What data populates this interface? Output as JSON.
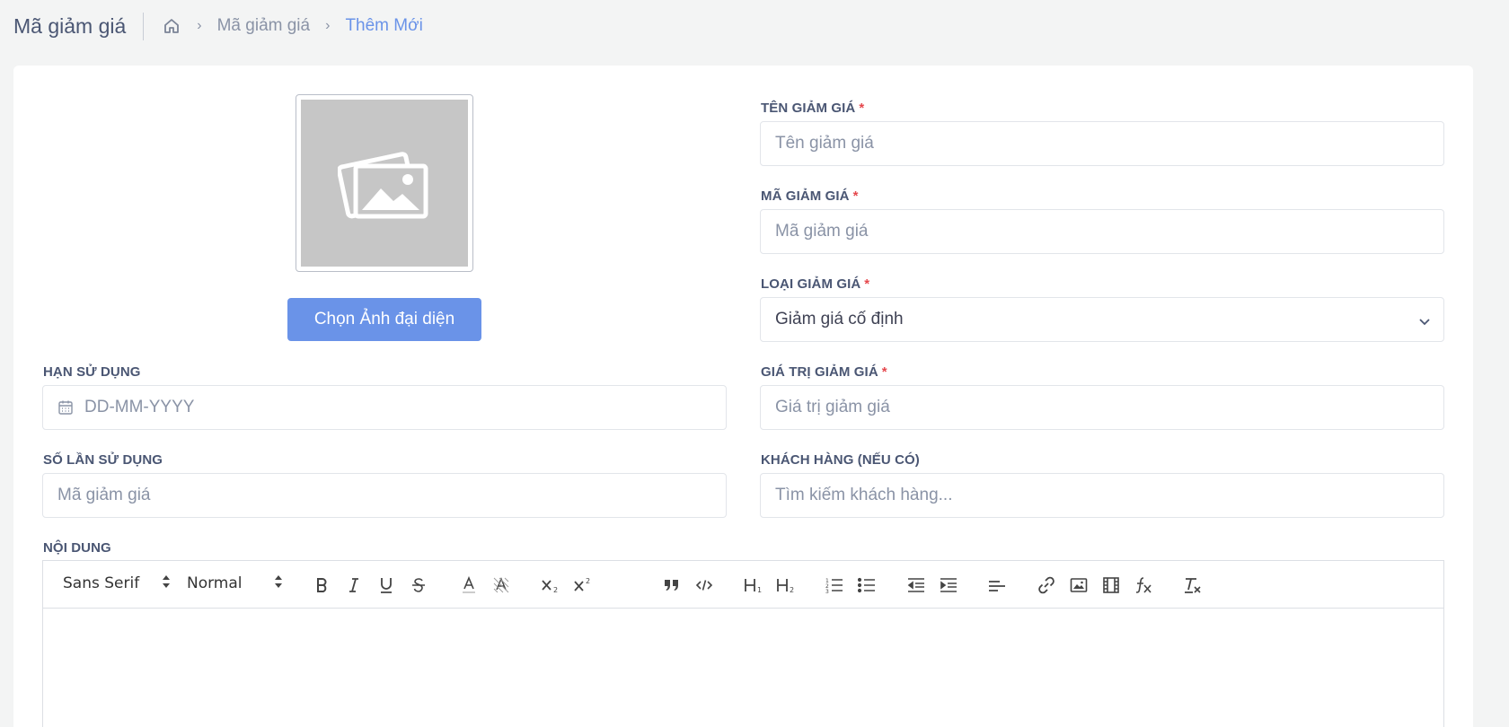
{
  "header": {
    "title": "Mã giảm giá",
    "breadcrumb": [
      {
        "label": "Mã giảm giá"
      },
      {
        "label": "Thêm Mới"
      }
    ]
  },
  "form": {
    "choose_image_label": "Chọn Ảnh đại diện",
    "fields": {
      "name": {
        "label": "TÊN GIẢM GIÁ",
        "required": "*",
        "placeholder": "Tên giảm giá",
        "value": ""
      },
      "code": {
        "label": "MÃ GIẢM GIÁ",
        "required": "*",
        "placeholder": "Mã giảm giá",
        "value": ""
      },
      "type": {
        "label": "LOẠI GIẢM GIÁ",
        "required": "*",
        "selected": "Giảm giá cố định"
      },
      "expiry": {
        "label": "HẠN SỬ DỤNG",
        "placeholder": "DD-MM-YYYY",
        "value": ""
      },
      "value": {
        "label": "GIÁ TRỊ GIẢM GIÁ",
        "required": "*",
        "placeholder": "Giá trị giảm giá",
        "value": ""
      },
      "usage_count": {
        "label": "SỐ LẦN SỬ DỤNG",
        "placeholder": "Mã giảm giá",
        "value": ""
      },
      "customer": {
        "label": "KHÁCH HÀNG (NẾU CÓ)",
        "placeholder": "Tìm kiếm khách hàng...",
        "value": ""
      },
      "content": {
        "label": "NỘI DUNG"
      }
    }
  },
  "editor": {
    "font_select": "Sans Serif",
    "size_select": "Normal",
    "buttons": [
      "bold-icon",
      "italic-icon",
      "underline-icon",
      "strike-icon",
      "font-color-icon",
      "background-color-icon",
      "subscript-icon",
      "superscript-icon",
      "blockquote-icon",
      "code-block-icon",
      "header1-icon",
      "header2-icon",
      "ordered-list-icon",
      "bullet-list-icon",
      "outdent-icon",
      "indent-icon",
      "align-icon",
      "link-icon",
      "image-icon",
      "video-icon",
      "formula-icon",
      "clean-icon"
    ]
  },
  "colors": {
    "accent": "#6a93e8",
    "required": "#e5484d",
    "background": "#f3f4f4"
  }
}
